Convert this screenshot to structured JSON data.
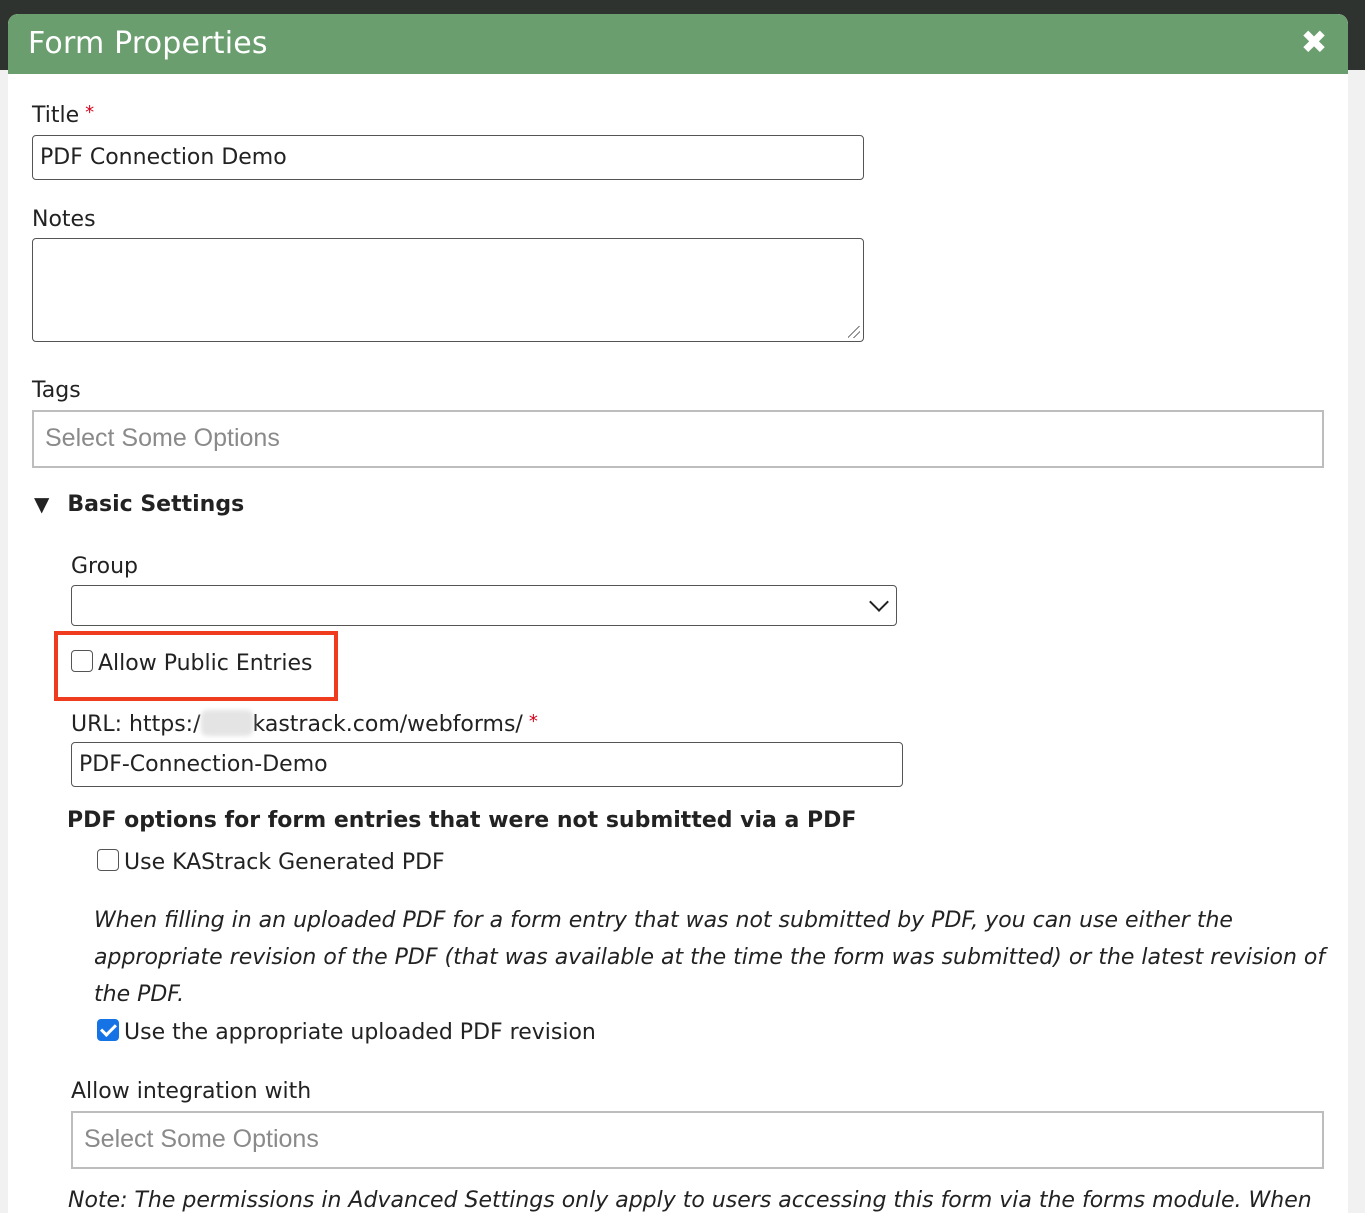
{
  "dialog": {
    "title": "Form Properties",
    "close_icon": "close-icon"
  },
  "fields": {
    "title_label": "Title",
    "title_value": "PDF Connection Demo",
    "required_mark": "*",
    "notes_label": "Notes",
    "notes_value": "",
    "tags_label": "Tags",
    "tags_placeholder": "Select Some Options"
  },
  "basic_settings": {
    "toggle_label": "Basic Settings",
    "expanded": true,
    "group_label": "Group",
    "group_selected": "",
    "allow_public_label": "Allow Public Entries",
    "allow_public_checked": false,
    "url_prefix": "URL: https:/",
    "url_suffix": "kastrack.com/webforms/",
    "url_value": "PDF-Connection-Demo",
    "pdf_heading": "PDF options for form entries that were not submitted via a PDF",
    "use_generated_label": "Use KAStrack Generated PDF",
    "use_generated_checked": false,
    "hint_text": "When filling in an uploaded PDF for a form entry that was not submitted by PDF, you can use either the appropriate revision of the PDF (that was available at the time the form was submitted) or the latest revision of the PDF.",
    "use_revision_label": "Use the appropriate uploaded PDF revision",
    "use_revision_checked": true,
    "integration_label": "Allow integration with",
    "integration_placeholder": "Select Some Options",
    "note_text": "Note: The permissions in Advanced Settings only apply to users accessing this form via the forms module. When"
  },
  "colors": {
    "header": "#6b9e6f",
    "highlight": "#ef3c1e",
    "checkbox_checked": "#1673e6",
    "required": "#d9001b"
  }
}
